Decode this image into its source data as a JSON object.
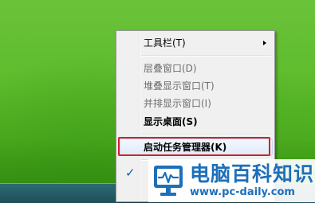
{
  "context_menu": {
    "items": [
      {
        "label": "工具栏(T)",
        "enabled": true,
        "has_submenu": true
      },
      {
        "label": "层叠窗口(D)",
        "enabled": false
      },
      {
        "label": "堆叠显示窗口(T)",
        "enabled": false
      },
      {
        "label": "并排显示窗口(I)",
        "enabled": false
      },
      {
        "label": "显示桌面(S)",
        "enabled": true
      },
      {
        "label": "启动任务管理器(K)",
        "enabled": true,
        "highlighted": true
      },
      {
        "label": "",
        "enabled": true,
        "checked": true
      }
    ]
  },
  "watermark": {
    "title": "电脑百科知识",
    "url": "www.pc-daily.com"
  },
  "colors": {
    "highlight_border": "#d0222a",
    "logo_blue": "#1d6fb9"
  },
  "icons": {
    "submenu_arrow": "chevron-right-icon",
    "check": "checkmark-icon",
    "logo": "monitor-logo-icon"
  }
}
